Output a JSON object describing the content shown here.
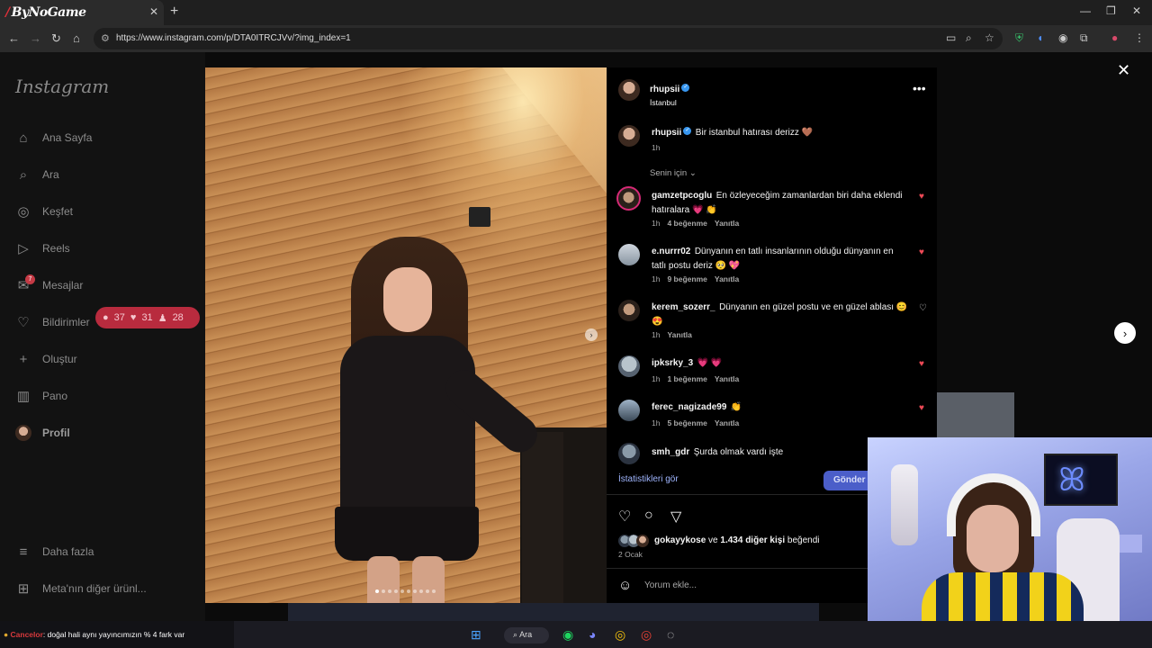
{
  "browser": {
    "tab_title": "ByNoGame",
    "url": "https://www.instagram.com/p/DTA0ITRCJVv/?img_index=1"
  },
  "sidebar": {
    "logo": "Instagram",
    "items": [
      {
        "label": "Ana Sayfa",
        "icon": "home-icon"
      },
      {
        "label": "Ara",
        "icon": "search-icon"
      },
      {
        "label": "Keşfet",
        "icon": "compass-icon"
      },
      {
        "label": "Reels",
        "icon": "reels-icon"
      },
      {
        "label": "Mesajlar",
        "icon": "messenger-icon"
      },
      {
        "label": "Bildirimler",
        "icon": "heart-icon"
      },
      {
        "label": "Oluştur",
        "icon": "plus-icon"
      },
      {
        "label": "Pano",
        "icon": "dashboard-icon"
      },
      {
        "label": "Profil",
        "icon": "avatar"
      },
      {
        "label": "Daha fazla",
        "icon": "menu-icon"
      },
      {
        "label": "Meta'nın diğer ürünl...",
        "icon": "meta-apps-icon"
      }
    ],
    "messages_badge": "7",
    "notifications": {
      "comments": "37",
      "likes": "31",
      "follows": "28"
    }
  },
  "post": {
    "author": "rhupsii",
    "location": "İstanbul",
    "caption": "Bir istanbul hatırası derizz 🤎",
    "caption_time": "1h",
    "sort_label": "Senin için",
    "comments": [
      {
        "user": "gamzetpcoglu",
        "text": "En özleyeceğim zamanlardan biri daha eklendi hatıralara 💗 👏",
        "time": "1h",
        "likes": "4 beğenme",
        "reply": "Yanıtla",
        "liked": true
      },
      {
        "user": "e.nurrr02",
        "text": "Dünyanın en tatlı insanlarının olduğu dünyanın en tatlı postu deriz 🥺 💖",
        "time": "1h",
        "likes": "9 beğenme",
        "reply": "Yanıtla",
        "liked": true
      },
      {
        "user": "kerem_sozerr_",
        "text": "Dünyanın en güzel postu ve en güzel ablası 😊 😍",
        "time": "1h",
        "likes": "",
        "reply": "Yanıtla",
        "liked": false
      },
      {
        "user": "ipksrky_3",
        "text": "💗 💗",
        "time": "1h",
        "likes": "1 beğenme",
        "reply": "Yanıtla",
        "liked": true
      },
      {
        "user": "ferec_nagizade99",
        "text": "👏",
        "time": "1h",
        "likes": "5 beğenme",
        "reply": "Yanıtla",
        "liked": true
      },
      {
        "user": "smh_gdr",
        "text": "Şurda olmak vardı işte",
        "time": "",
        "likes": "",
        "reply": "",
        "liked": false
      }
    ],
    "stats_link": "İstatistikleri gör",
    "send_button": "Gönder",
    "liked_by_user": "gokayykose",
    "liked_by_rest": "ve",
    "liked_by_count": "1.434 diğer kişi",
    "liked_by_suffix": "beğendi",
    "date": "2 Ocak",
    "comment_placeholder": "Yorum ekle..."
  },
  "taskbar": {
    "ticker_brand": "Cancelor",
    "ticker_text": ": doğal hali aynı yayıncımızın % 4 fark var",
    "search_label": "Ara"
  },
  "colors": {
    "like": "#ed4956",
    "verified": "#3897f0",
    "accent": "#4b5ec9"
  }
}
